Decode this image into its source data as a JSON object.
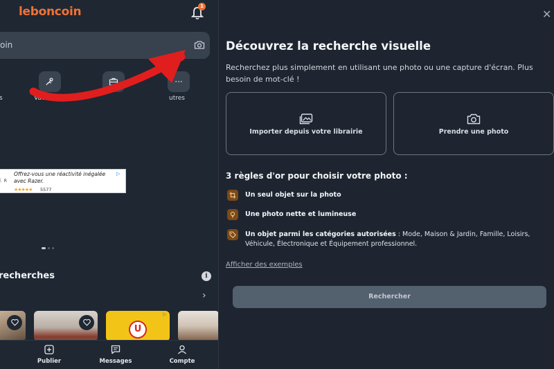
{
  "app": {
    "logo_text": "leboncoin",
    "notification_count": "1",
    "search_placeholder": "oin"
  },
  "categories": [
    {
      "label": "s",
      "icon": "category-icon"
    },
    {
      "label": "Vac",
      "icon": "beach-icon"
    },
    {
      "label": "",
      "icon": "briefcase-icon"
    },
    {
      "label": "utres",
      "icon": "more-icon"
    }
  ],
  "ad": {
    "text": "Offrez-vous une réactivité inégalée avec Razer.",
    "brand": "E R",
    "stars": "★★★★★",
    "rating_count": "5577"
  },
  "recent": {
    "title": "recherches",
    "info_icon": "i"
  },
  "bottom_nav": [
    {
      "label": "Publier",
      "icon": "plus-square-icon"
    },
    {
      "label": "Messages",
      "icon": "message-icon"
    },
    {
      "label": "Compte",
      "icon": "user-icon"
    }
  ],
  "visual_search": {
    "title": "Découvrez la recherche visuelle",
    "description": "Recherchez plus simplement en utilisant une photo ou une capture d'écran. Plus besoin de mot-clé !",
    "import_label": "Importer depuis votre librairie",
    "photo_label": "Prendre une photo",
    "rules_title": "3 règles d'or pour choisir votre photo :",
    "rules": [
      {
        "bold": "Un seul objet sur la photo",
        "rest": ""
      },
      {
        "bold": "Une photo nette et lumineuse",
        "rest": ""
      },
      {
        "bold": "Un objet parmi les catégories autorisées",
        "rest": " : Mode, Maison & Jardin, Famille, Loisirs, Véhicule, Électronique et Équipement professionnel."
      }
    ],
    "examples_link": "Afficher des exemples",
    "search_button": "Rechercher"
  },
  "colors": {
    "brand_orange": "#f07236",
    "background": "#1e2530",
    "arrow_red": "#e01e1e"
  }
}
